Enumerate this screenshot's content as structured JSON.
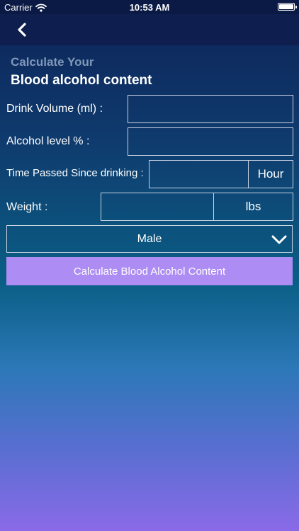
{
  "status_bar": {
    "carrier": "Carrier",
    "time": "10:53 AM"
  },
  "nav": {
    "back_icon": "chevron-left-icon"
  },
  "header": {
    "subtitle": "Calculate Your",
    "title": "Blood alcohol content"
  },
  "form": {
    "drink_volume_label": "Drink Volume (ml) :",
    "drink_volume_value": "",
    "alcohol_level_label": "Alcohol level % :",
    "alcohol_level_value": "",
    "time_passed_label": "Time Passed Since drinking :",
    "time_passed_value": "",
    "time_unit": "Hour",
    "weight_label": "Weight :",
    "weight_value": "",
    "weight_unit": "lbs",
    "gender_selected": "Male",
    "gender_icon": "chevron-down-icon",
    "calculate_label": "Calculate Blood Alcohol Content"
  },
  "colors": {
    "button_bg": "#ad8cf3",
    "field_border": "#c9d3e3",
    "subtitle": "#7f97b8"
  }
}
